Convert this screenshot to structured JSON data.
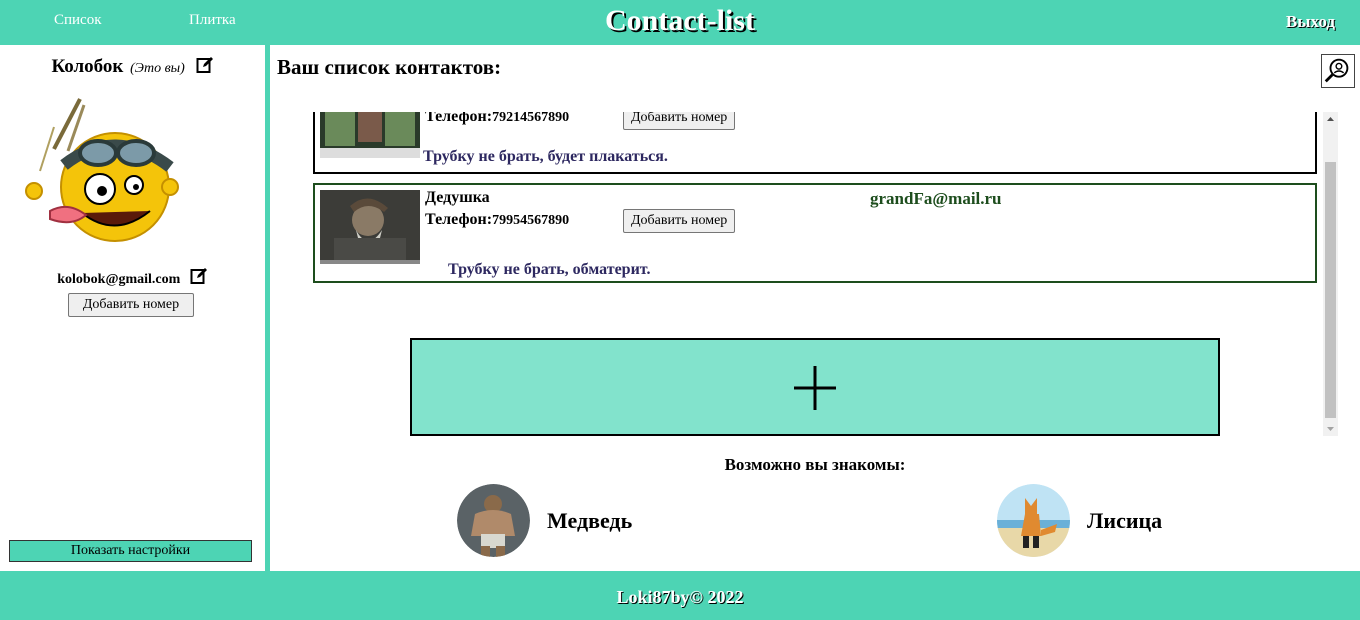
{
  "header": {
    "nav_list": "Список",
    "nav_tile": "Плитка",
    "title": "Contact-list",
    "logout": "Выход"
  },
  "profile": {
    "name": "Колобок",
    "you_label": "(Это вы)",
    "email": "kolobok@gmail.com",
    "add_number": "Добавить номер",
    "show_settings": "Показать настройки"
  },
  "main": {
    "heading": "Ваш список контактов:",
    "contacts": [
      {
        "name": "",
        "phone_label": "Телефон:",
        "phone": "79214567890",
        "add_number": "Добавить номер",
        "email": "",
        "note": "Трубку не брать, будет плакаться.",
        "border_color": "#000000"
      },
      {
        "name": "Дедушка",
        "phone_label": "Телефон:",
        "phone": "79954567890",
        "add_number": "Добавить номер",
        "email": "grandFa@mail.ru",
        "note": "Трубку не брать, обматерит.",
        "border_color": "#1d4d1d"
      }
    ],
    "suggest_heading": "Возможно вы знакомы:",
    "suggestions": [
      {
        "name": "Медведь"
      },
      {
        "name": "Лисица"
      }
    ]
  },
  "footer": {
    "text": "Loki87by© 2022"
  },
  "colors": {
    "accent": "#4dd4b4",
    "add_box": "#82e3cc"
  }
}
